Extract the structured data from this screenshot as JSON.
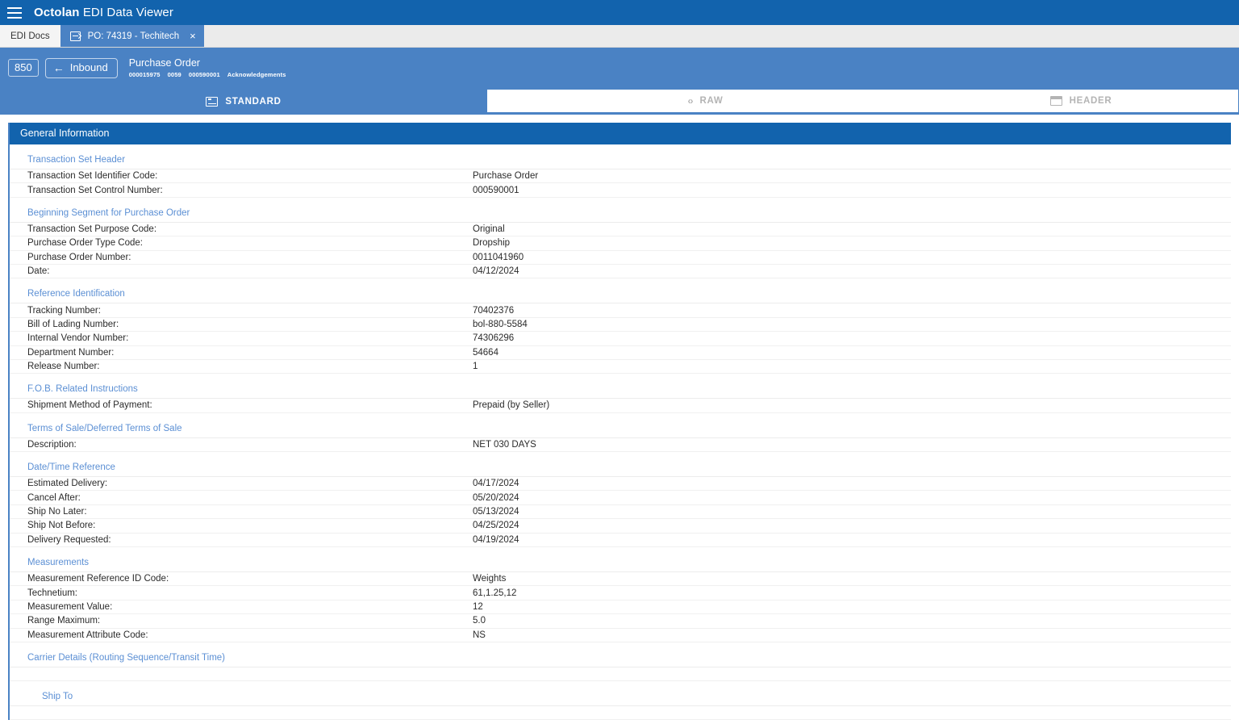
{
  "appbar": {
    "menu_icon": "hamburger-icon",
    "brand": "Octolan",
    "title_rest": " EDI Data Viewer"
  },
  "tabs": [
    {
      "label": "EDI Docs",
      "active": false
    },
    {
      "label": "PO: 74319 - Techitech",
      "active": true,
      "icon": "document-export-icon",
      "close": "×"
    }
  ],
  "subheader": {
    "transaction_code": "850",
    "direction_label": "Inbound",
    "direction_arrow": "←",
    "doc_title": "Purchase Order",
    "doc_ids": [
      "000015975",
      "0059",
      "000590001",
      "Acknowledgements"
    ]
  },
  "view_tabs": [
    {
      "label": "STANDARD",
      "icon": "standard-view-icon",
      "active": true
    },
    {
      "label": "RAW",
      "icon": "code-brackets-icon",
      "active": false
    },
    {
      "label": "HEADER",
      "icon": "header-view-icon",
      "active": false
    }
  ],
  "raw_icon_glyph": "‹›",
  "section": {
    "title": "General Information",
    "groups": [
      {
        "heading": "Transaction Set Header",
        "indent": false,
        "fields": [
          {
            "label": "Transaction Set Identifier Code:",
            "value": "Purchase Order"
          },
          {
            "label": "Transaction Set Control Number:",
            "value": "000590001"
          }
        ]
      },
      {
        "heading": "Beginning Segment for Purchase Order",
        "indent": false,
        "fields": [
          {
            "label": "Transaction Set Purpose Code:",
            "value": "Original"
          },
          {
            "label": "Purchase Order Type Code:",
            "value": "Dropship"
          },
          {
            "label": "Purchase Order Number:",
            "value": "0011041960"
          },
          {
            "label": "Date:",
            "value": "04/12/2024"
          }
        ]
      },
      {
        "heading": "Reference Identification",
        "indent": false,
        "fields": [
          {
            "label": "Tracking Number:",
            "value": "70402376"
          },
          {
            "label": "Bill of Lading Number:",
            "value": "bol-880-5584"
          },
          {
            "label": "Internal Vendor Number:",
            "value": "74306296"
          },
          {
            "label": "Department Number:",
            "value": "54664"
          },
          {
            "label": "Release Number:",
            "value": "1"
          }
        ]
      },
      {
        "heading": "F.O.B. Related Instructions",
        "indent": false,
        "fields": [
          {
            "label": "Shipment Method of Payment:",
            "value": "Prepaid (by Seller)"
          }
        ]
      },
      {
        "heading": "Terms of Sale/Deferred Terms of Sale",
        "indent": false,
        "fields": [
          {
            "label": "Description:",
            "value": "NET 030 DAYS"
          }
        ]
      },
      {
        "heading": "Date/Time Reference",
        "indent": false,
        "fields": [
          {
            "label": "Estimated Delivery:",
            "value": "04/17/2024"
          },
          {
            "label": "Cancel After:",
            "value": "05/20/2024"
          },
          {
            "label": "Ship No Later:",
            "value": "05/13/2024"
          },
          {
            "label": "Ship Not Before:",
            "value": "04/25/2024"
          },
          {
            "label": "Delivery Requested:",
            "value": "04/19/2024"
          }
        ]
      },
      {
        "heading": "Measurements",
        "indent": false,
        "fields": [
          {
            "label": "Measurement Reference ID Code:",
            "value": "Weights"
          },
          {
            "label": "Technetium:",
            "value": "61,1.25,12"
          },
          {
            "label": "Measurement Value:",
            "value": "12"
          },
          {
            "label": "Range Maximum:",
            "value": "5.0"
          },
          {
            "label": "Measurement Attribute Code:",
            "value": "NS"
          }
        ]
      },
      {
        "heading": "Carrier Details (Routing Sequence/Transit Time)",
        "indent": false,
        "fields": []
      },
      {
        "heading": "Ship To",
        "indent": true,
        "fields": []
      }
    ]
  },
  "colors": {
    "appbar_blue": "#1263ad",
    "subheader_blue": "#4a82c4",
    "group_heading_blue": "#5b8fd4",
    "text": "#2b2b2b"
  }
}
